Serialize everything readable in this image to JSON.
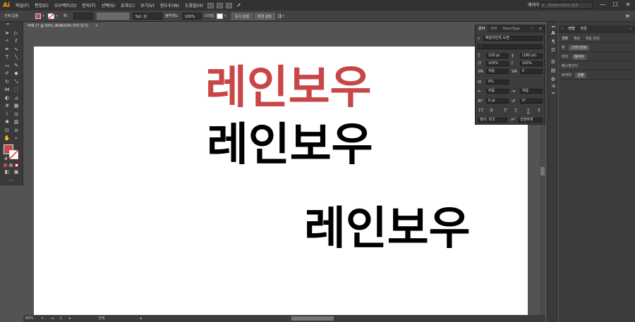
{
  "app": {
    "logo": "Ai"
  },
  "menu": [
    "파일(F)",
    "편집(E)",
    "오브젝트(O)",
    "문자(T)",
    "선택(S)",
    "효과(C)",
    "보기(V)",
    "윈도우(W)",
    "도움말(H)"
  ],
  "workspace": "레이아웃",
  "search_placeholder": "Adobe Stock 검색",
  "window_buttons": [
    "—",
    "☐",
    "✕"
  ],
  "control": {
    "no_selection": "선택 없음",
    "stroke_label": "획:",
    "brush": "5pt. 원",
    "opacity_label": "불투명도",
    "opacity_value": "100%",
    "style_label": "스타일:",
    "doc_setup": "문서 설정",
    "prefs": "환경 설정"
  },
  "document_tab": {
    "title": "무제-1* @ 83% (RGB/GPU 미리 보기)",
    "close": "×"
  },
  "canvas": {
    "texts": [
      {
        "text": "레인보우",
        "color": "#c84646"
      },
      {
        "text": "레인보우",
        "color": "#000000"
      },
      {
        "text": "레인보우",
        "color": "#000000"
      }
    ]
  },
  "status": {
    "zoom": "83%",
    "page": "1",
    "mode": "선택"
  },
  "char_panel": {
    "tabs": [
      "문자",
      "단락",
      "OpenType"
    ],
    "font_family": "배달의민족 도현",
    "font_style": "-",
    "size": "150 pt",
    "leading": "(180 pt)",
    "vscale": "100%",
    "hscale": "100%",
    "kerning": "자동",
    "tracking": "0",
    "tsume": "0%",
    "aki_left": "자동",
    "aki_right": "자동",
    "baseline": "0 pt",
    "rotation": "0°",
    "caps": [
      "TT",
      "Tr",
      "T'",
      "T,",
      "T",
      "Ŧ"
    ],
    "language": "영어: 미국",
    "antialias": "선명하게"
  },
  "right_panel": {
    "header_tabs": [
      "변형",
      "정렬"
    ],
    "rows": [
      {
        "label": "견본",
        "extra": [
          "색상",
          "색상 안내"
        ]
      },
      {
        "label": "획",
        "chip": "그라디언트"
      },
      {
        "label": "대지",
        "chip": "레이어"
      },
      {
        "label": "패스파인더",
        "chip": ""
      },
      {
        "label": "브러쉬",
        "chip": "심볼"
      }
    ]
  },
  "tool_icons": [
    "selection-icon",
    "direct-selection-icon",
    "magic-wand-icon",
    "lasso-icon",
    "pen-icon",
    "curvature-icon",
    "type-icon",
    "line-icon",
    "rectangle-icon",
    "paintbrush-icon",
    "shaper-icon",
    "eraser-icon",
    "rotate-icon",
    "scale-icon",
    "width-icon",
    "free-transform-icon",
    "shape-builder-icon",
    "perspective-icon",
    "mesh-icon",
    "gradient-icon",
    "eyedropper-icon",
    "blend-icon",
    "symbol-sprayer-icon",
    "graph-icon",
    "artboard-icon",
    "slice-icon",
    "hand-icon",
    "zoom-icon"
  ],
  "colors": {
    "fill": "#c84b4b",
    "accent": "#ff9a00"
  }
}
